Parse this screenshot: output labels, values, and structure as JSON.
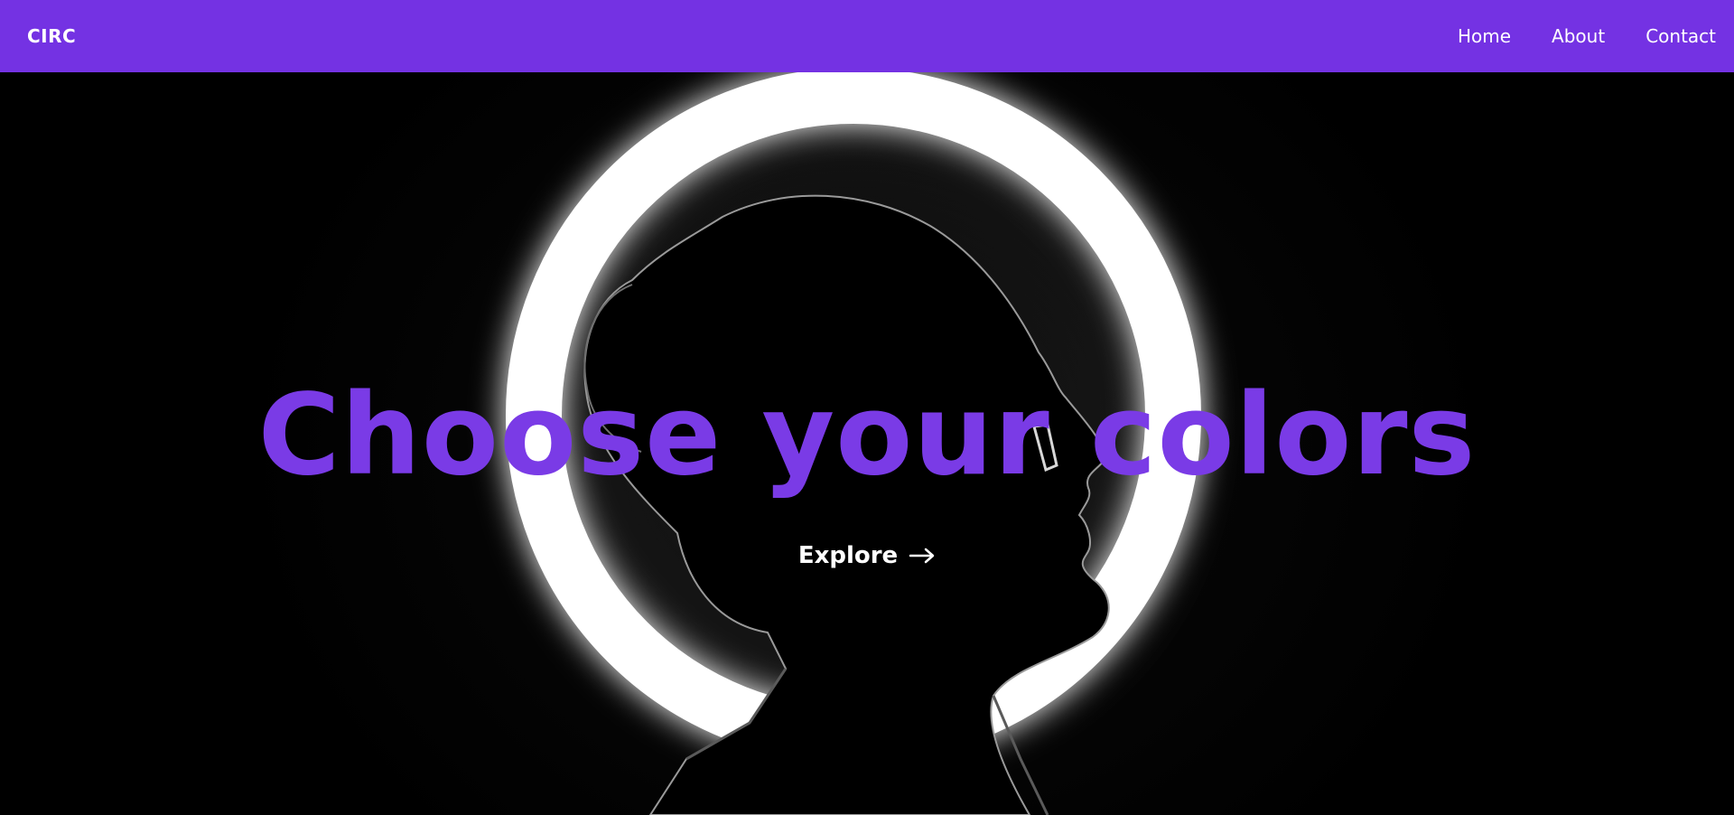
{
  "nav": {
    "brand": "CIRC",
    "links": [
      {
        "label": "Home"
      },
      {
        "label": "About"
      },
      {
        "label": "Contact"
      }
    ]
  },
  "hero": {
    "title": "Choose your colors",
    "cta_label": "Explore",
    "cta_icon": "arrow-right-icon",
    "background_image": "silhouette of a person in profile in front of a glowing ring light"
  },
  "colors": {
    "accent": "#7432e3",
    "title": "#7a3be6",
    "background": "#000000",
    "text": "#ffffff"
  }
}
